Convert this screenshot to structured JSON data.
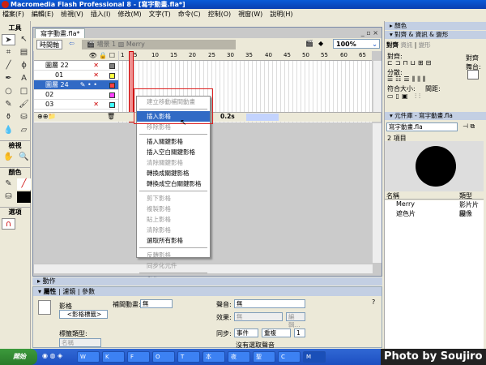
{
  "title": "Macromedia Flash Professional 8 - [寫字動畫.fla*]",
  "menu": [
    "檔案(F)",
    "編輯(E)",
    "檢視(V)",
    "插入(I)",
    "修改(M)",
    "文字(T)",
    "命令(C)",
    "控制(O)",
    "視窗(W)",
    "說明(H)"
  ],
  "toolbox": {
    "title": "工具",
    "view": "檢視",
    "colors": "顏色",
    "options": "選項"
  },
  "document": {
    "tab": "寫字動畫.fla*",
    "timeline_button": "時間軸",
    "scene": "場景 1",
    "symbol": "Merry",
    "zoom": "100%",
    "ruler": [
      "1",
      "5",
      "10",
      "15",
      "20",
      "25",
      "30",
      "35",
      "40",
      "45",
      "50",
      "55",
      "60",
      "65"
    ],
    "layers": [
      {
        "name": "圖層 22",
        "color": "#808080"
      },
      {
        "name": "01",
        "color": "#ffff40"
      },
      {
        "name": "圖層 24",
        "color": "#ff4040"
      },
      {
        "name": "02",
        "color": "#ff40ff"
      },
      {
        "name": "03",
        "color": "#40ffff"
      }
    ],
    "frame_rate": "0.2s"
  },
  "context_menu": [
    {
      "label": "建立移動補間動畫",
      "enabled": false
    },
    {
      "sep": true
    },
    {
      "label": "插入影格",
      "enabled": true,
      "highlight": true
    },
    {
      "label": "移除影格",
      "enabled": false
    },
    {
      "sep": true
    },
    {
      "label": "插入關鍵影格",
      "enabled": true
    },
    {
      "label": "插入空白關鍵影格",
      "enabled": true
    },
    {
      "label": "清除關鍵影格",
      "enabled": false
    },
    {
      "label": "轉換成關鍵影格",
      "enabled": true
    },
    {
      "label": "轉換成空白關鍵影格",
      "enabled": true
    },
    {
      "sep": true
    },
    {
      "label": "剪下影格",
      "enabled": false
    },
    {
      "label": "複製影格",
      "enabled": false
    },
    {
      "label": "貼上影格",
      "enabled": false
    },
    {
      "label": "清除影格",
      "enabled": false
    },
    {
      "label": "選取所有影格",
      "enabled": true
    },
    {
      "sep": true
    },
    {
      "label": "反轉影格",
      "enabled": false
    },
    {
      "label": "同步化元件",
      "enabled": false
    },
    {
      "sep": true
    },
    {
      "label": "動作",
      "enabled": true
    }
  ],
  "actions_panel": "動作",
  "properties": {
    "tabs": [
      "屬性",
      "濾鏡",
      "參數"
    ],
    "frame_label": "影格",
    "frame_name_placeholder": "<影格標籤>",
    "label_type": "標籤類型:",
    "label_type_value": "名稱",
    "tween": "補間動畫:",
    "tween_value": "無",
    "sound": "聲音:",
    "sound_value": "無",
    "effect": "效果:",
    "effect_value": "無",
    "edit": "編輯...",
    "sync": "同步:",
    "sync_value": "事件",
    "repeat_value": "重複",
    "repeat_count": "1",
    "no_sound": "沒有選取聲音"
  },
  "right": {
    "color_panel": "顏色",
    "align_panel": "對齊 & 資訊 & 變形",
    "align_tabs": [
      "對齊",
      "資訊",
      "變形"
    ],
    "align": "對齊:",
    "distribute": "分散:",
    "match_size": "符合大小:",
    "spacing": "間距:",
    "to_stage": "對齊舞台:",
    "library_panel": "元件庫 - 寫字動畫.fla",
    "library_select": "寫字動畫.fla",
    "item_count": "2 項目",
    "col_name": "名稱",
    "col_type": "類型",
    "items": [
      {
        "name": "Merry",
        "type": "影片片段"
      },
      {
        "name": "遮色片",
        "type": "圖像"
      }
    ]
  },
  "taskbar": {
    "start": "開始",
    "buttons": [
      "W",
      "K",
      "F",
      "O",
      "T",
      "本",
      "夜",
      "聖",
      "C",
      "M"
    ],
    "watermark": "Photo by Soujiro"
  }
}
